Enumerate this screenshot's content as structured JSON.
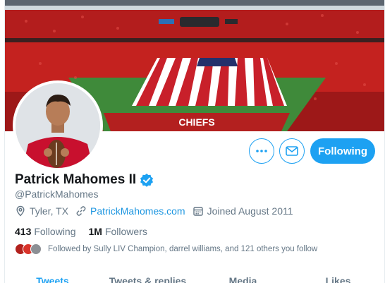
{
  "profile": {
    "display_name": "Patrick Mahomes II",
    "handle": "@PatrickMahomes",
    "location": "Tyler, TX",
    "website": "PatrickMahomes.com",
    "joined": "Joined August 2011",
    "following_count": "413",
    "following_label": "Following",
    "followers_count": "1M",
    "followers_label": "Followers",
    "followed_by": "Followed by Sully LIV Champion, darrel williams, and 121 others you follow"
  },
  "banner": {
    "field_text": "CHIEFS"
  },
  "actions": {
    "follow_button": "Following"
  },
  "tabs": [
    {
      "label": "Tweets",
      "active": true
    },
    {
      "label": "Tweets & replies",
      "active": false
    },
    {
      "label": "Media",
      "active": false
    },
    {
      "label": "Likes",
      "active": false
    }
  ],
  "colors": {
    "accent": "#1da1f2",
    "link": "#1b95e0",
    "secondary_text": "#657786",
    "primary_text": "#14171a"
  },
  "icons": {
    "more": "more-icon",
    "message": "envelope-icon",
    "verified": "verified-badge-icon",
    "location": "location-pin-icon",
    "link": "link-icon",
    "calendar": "calendar-icon"
  }
}
